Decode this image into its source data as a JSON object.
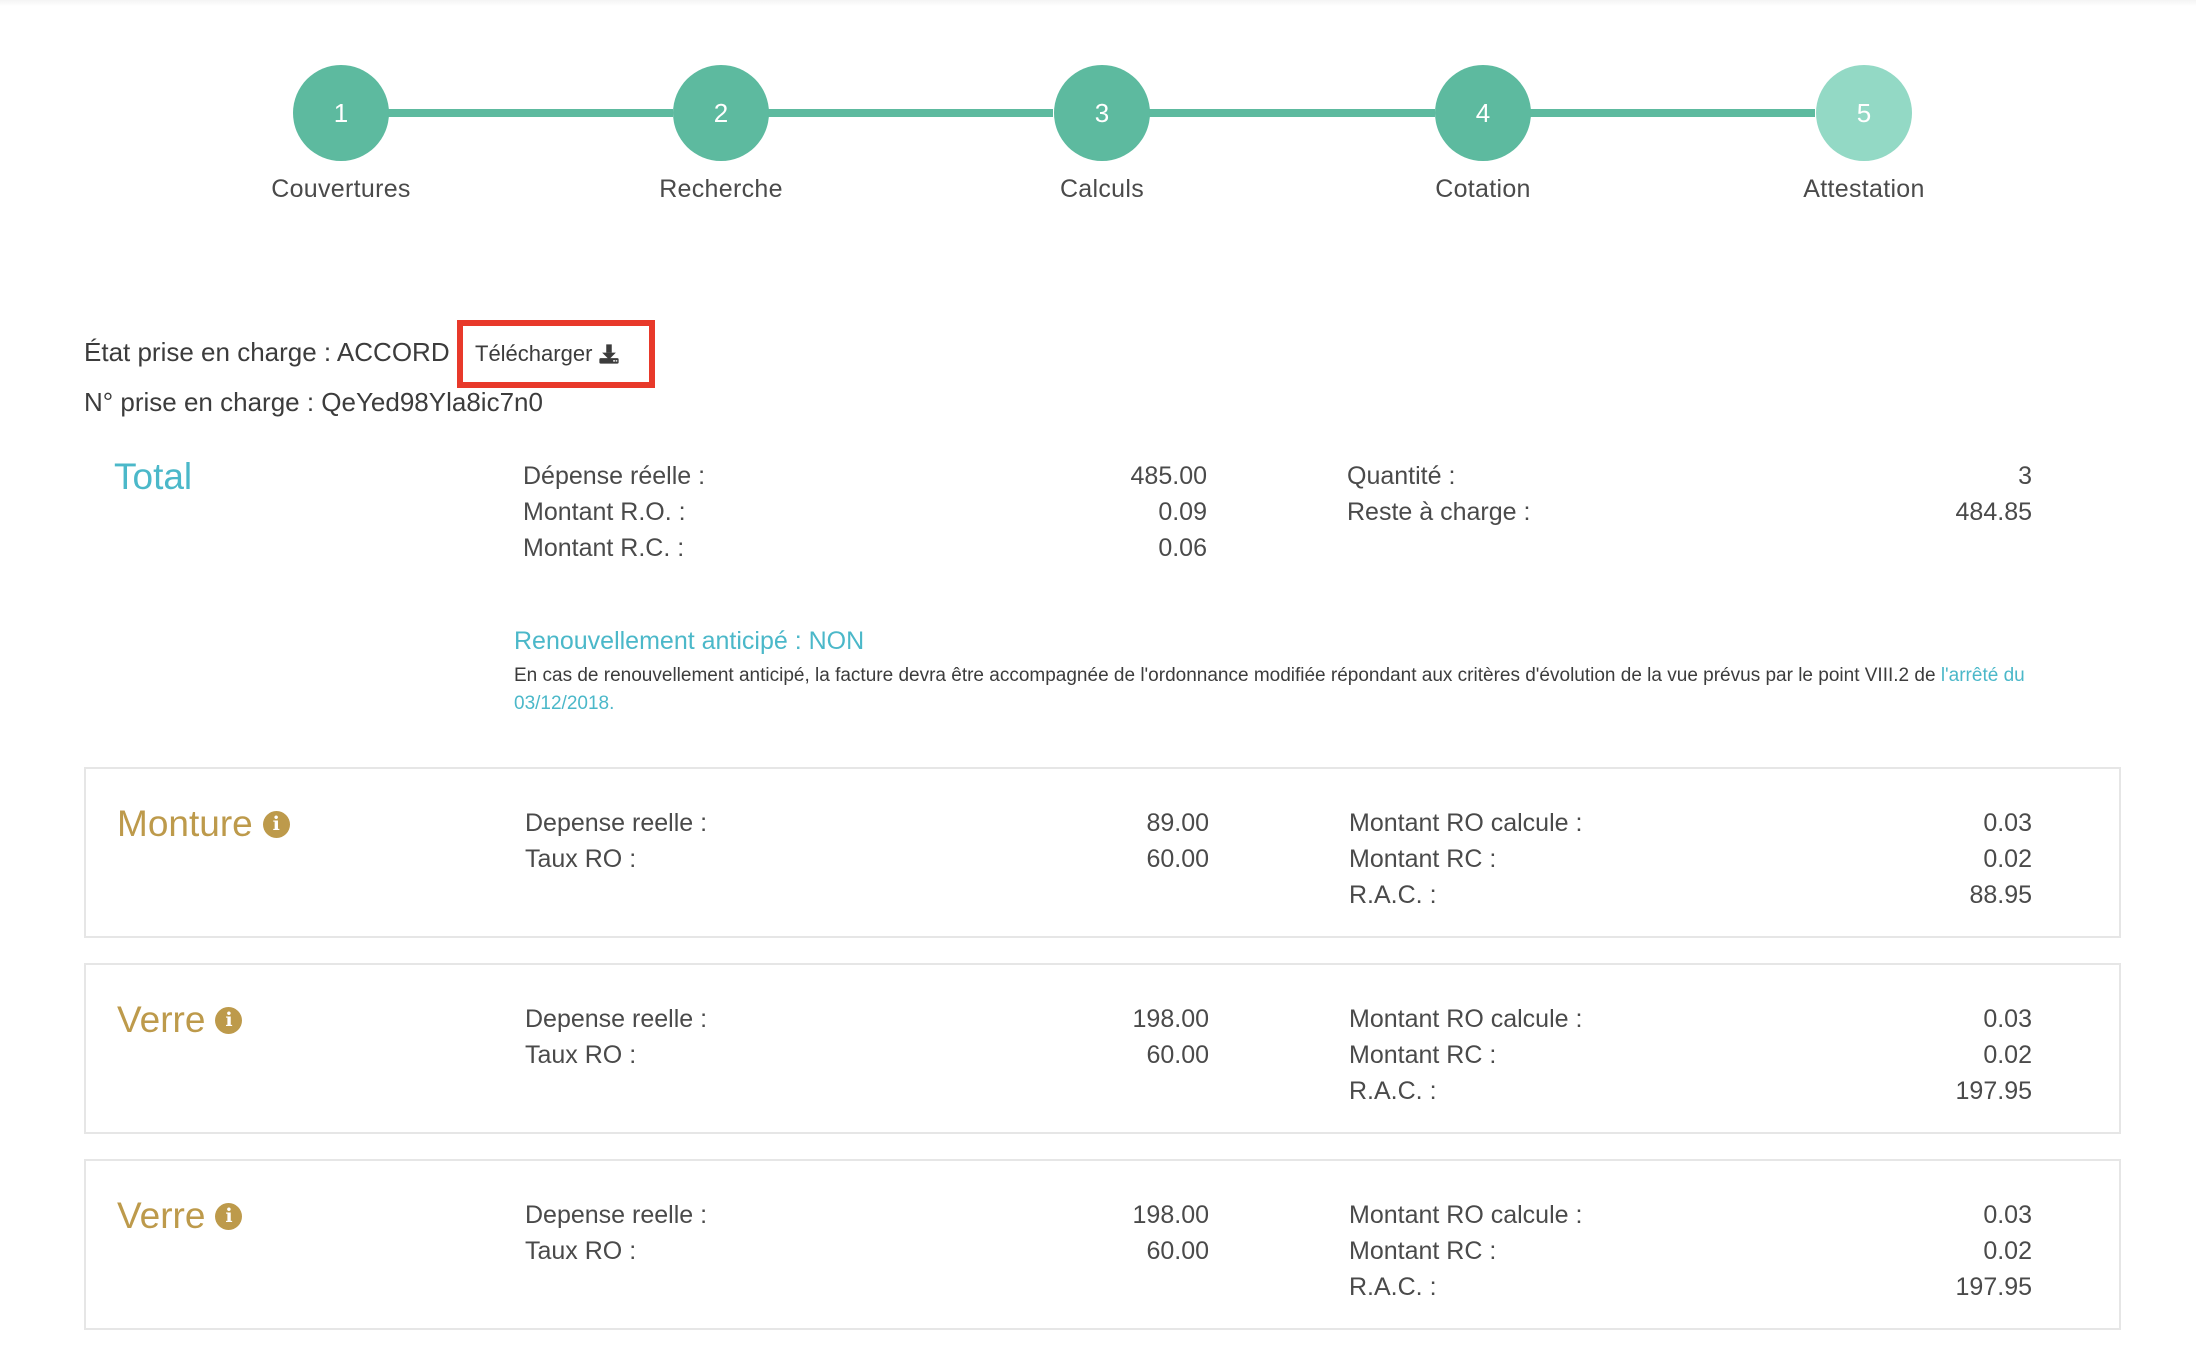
{
  "stepper": {
    "steps": [
      {
        "number": "1",
        "label": "Couvertures"
      },
      {
        "number": "2",
        "label": "Recherche"
      },
      {
        "number": "3",
        "label": "Calculs"
      },
      {
        "number": "4",
        "label": "Cotation"
      },
      {
        "number": "5",
        "label": "Attestation"
      }
    ],
    "current_step": 5,
    "colors": {
      "done": "#5dba9f",
      "upcoming": "#93d9c5"
    }
  },
  "status": {
    "state_label": "État prise en charge : ACCORD",
    "download_label": "Télécharger",
    "download_icon": "download-icon",
    "number_label": "N° prise en charge : QeYed98Yla8ic7n0"
  },
  "total": {
    "title": "Total",
    "left": [
      {
        "label": "Dépense réelle :",
        "value": "485.00"
      },
      {
        "label": "Montant R.O. :",
        "value": "0.09"
      },
      {
        "label": "Montant R.C. :",
        "value": "0.06"
      }
    ],
    "right": [
      {
        "label": "Quantité :",
        "value": "3"
      },
      {
        "label": "Reste à charge :",
        "value": "484.85"
      }
    ]
  },
  "renewal": {
    "title": "Renouvellement anticipé : NON",
    "note": "En cas de renouvellement anticipé, la facture devra être accompagnée de l'ordonnance modifiée répondant aux critères d'évolution de la vue prévus par le point VIII.2 de ",
    "link": "l'arrêté du 03/12/2018."
  },
  "items": [
    {
      "title": "Monture",
      "left": [
        {
          "label": "Depense reelle :",
          "value": "89.00"
        },
        {
          "label": "Taux RO :",
          "value": "60.00"
        }
      ],
      "right": [
        {
          "label": "Montant RO calcule :",
          "value": "0.03"
        },
        {
          "label": "Montant RC :",
          "value": "0.02"
        },
        {
          "label": "R.A.C. :",
          "value": "88.95"
        }
      ]
    },
    {
      "title": "Verre",
      "left": [
        {
          "label": "Depense reelle :",
          "value": "198.00"
        },
        {
          "label": "Taux RO :",
          "value": "60.00"
        }
      ],
      "right": [
        {
          "label": "Montant RO calcule :",
          "value": "0.03"
        },
        {
          "label": "Montant RC :",
          "value": "0.02"
        },
        {
          "label": "R.A.C. :",
          "value": "197.95"
        }
      ]
    },
    {
      "title": "Verre",
      "left": [
        {
          "label": "Depense reelle :",
          "value": "198.00"
        },
        {
          "label": "Taux RO :",
          "value": "60.00"
        }
      ],
      "right": [
        {
          "label": "Montant RO calcule :",
          "value": "0.03"
        },
        {
          "label": "Montant RC :",
          "value": "0.02"
        },
        {
          "label": "R.A.C. :",
          "value": "197.95"
        }
      ]
    }
  ],
  "colors": {
    "accent_teal": "#4bb8c9",
    "accent_gold": "#bd9a4b",
    "highlight_red": "#e8392a"
  }
}
